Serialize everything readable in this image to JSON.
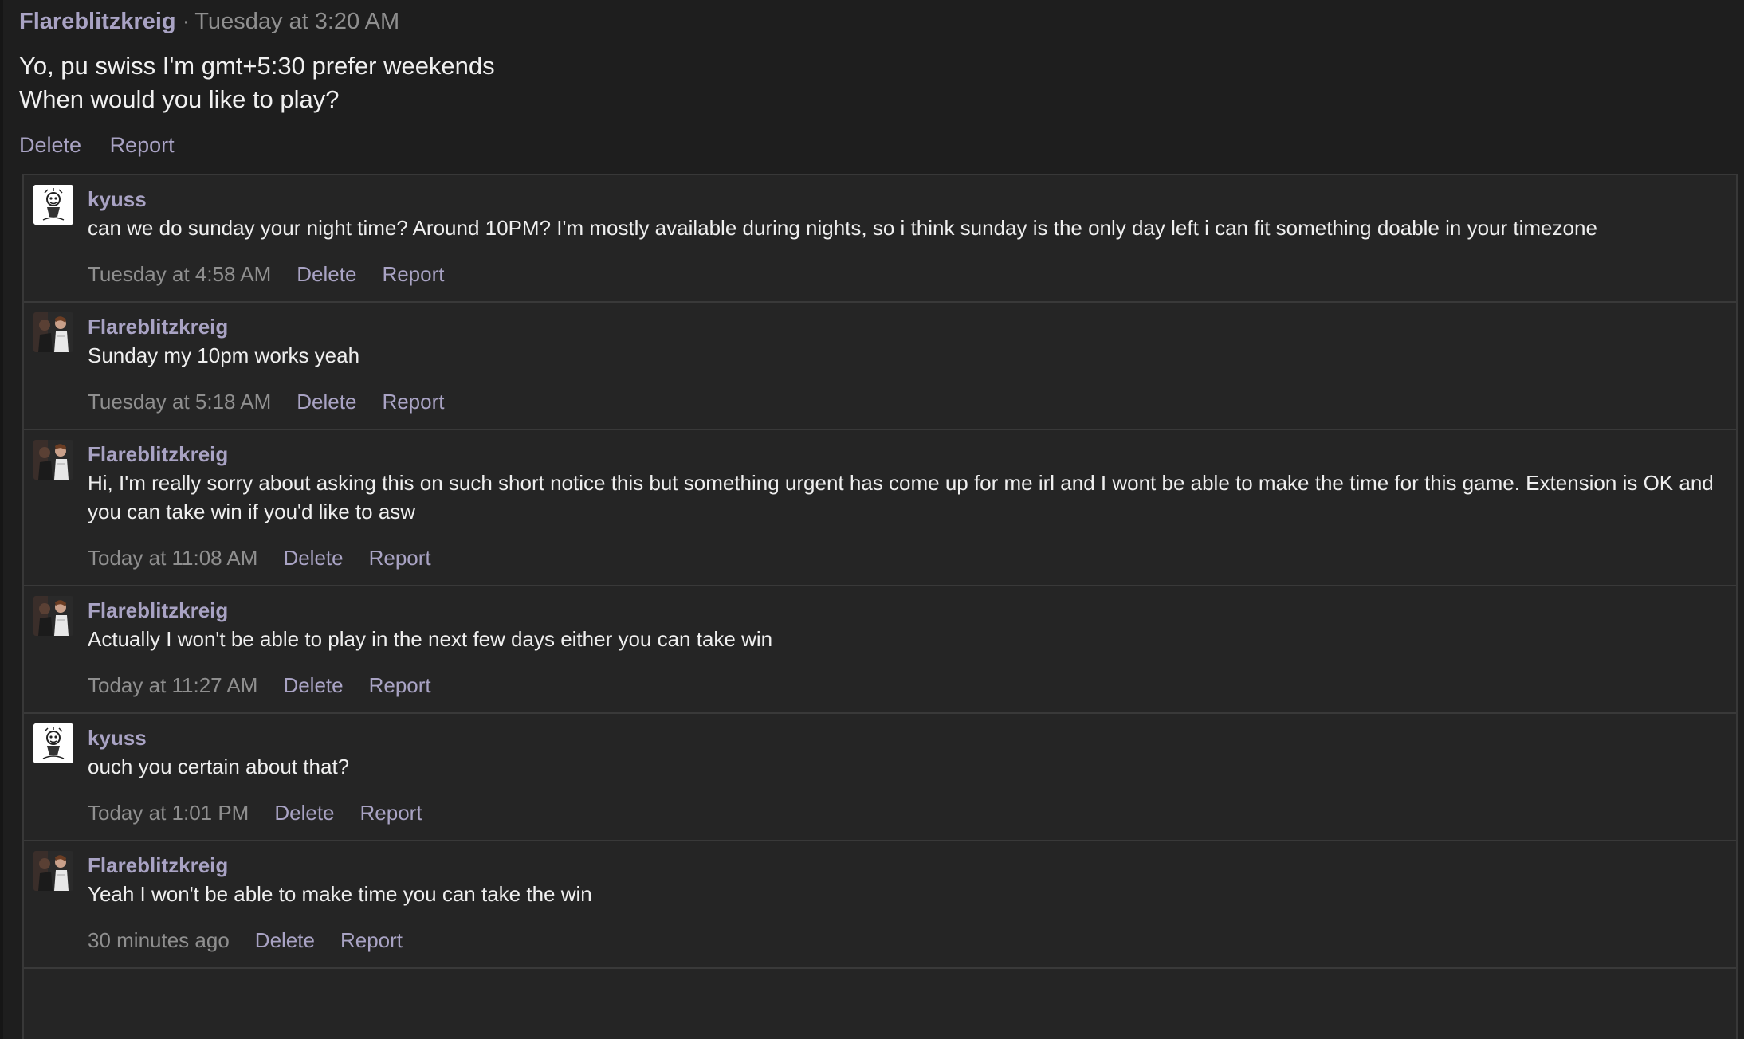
{
  "post": {
    "author": "Flareblitzkreig",
    "separator": "·",
    "time": "Tuesday at 3:20 AM",
    "lines": [
      "Yo, pu swiss I'm gmt+5:30 prefer weekends",
      "When would you like to play?"
    ],
    "actions": {
      "delete": "Delete",
      "report": "Report"
    }
  },
  "replies": [
    {
      "author": "kyuss",
      "avatar": "kyuss",
      "text": "can we do sunday your night time? Around 10PM? I'm mostly available during nights, so i think sunday is the only day left i can fit something doable in your timezone",
      "time": "Tuesday at 4:58 AM",
      "delete": "Delete",
      "report": "Report"
    },
    {
      "author": "Flareblitzkreig",
      "avatar": "flare",
      "text": "Sunday my 10pm works yeah",
      "time": "Tuesday at 5:18 AM",
      "delete": "Delete",
      "report": "Report"
    },
    {
      "author": "Flareblitzkreig",
      "avatar": "flare",
      "text": "Hi, I'm really sorry about asking this on such short notice this but something urgent has come up for me irl and I wont be able to make the time for this game. Extension is OK and you can take win if you'd like to asw",
      "time": "Today at 11:08 AM",
      "delete": "Delete",
      "report": "Report"
    },
    {
      "author": "Flareblitzkreig",
      "avatar": "flare",
      "text": "Actually I won't be able to play in the next few days either you can take win",
      "time": "Today at 11:27 AM",
      "delete": "Delete",
      "report": "Report"
    },
    {
      "author": "kyuss",
      "avatar": "kyuss",
      "text": "ouch you certain about that?",
      "time": "Today at 1:01 PM",
      "delete": "Delete",
      "report": "Report"
    },
    {
      "author": "Flareblitzkreig",
      "avatar": "flare",
      "text": "Yeah I won't be able to make time you can take the win",
      "time": "30 minutes ago",
      "delete": "Delete",
      "report": "Report"
    }
  ],
  "colors": {
    "background": "#1e1e1e",
    "thread_background": "#252525",
    "username": "#a9a3c4",
    "timestamp": "#8f8f8f",
    "text": "#efefef"
  }
}
